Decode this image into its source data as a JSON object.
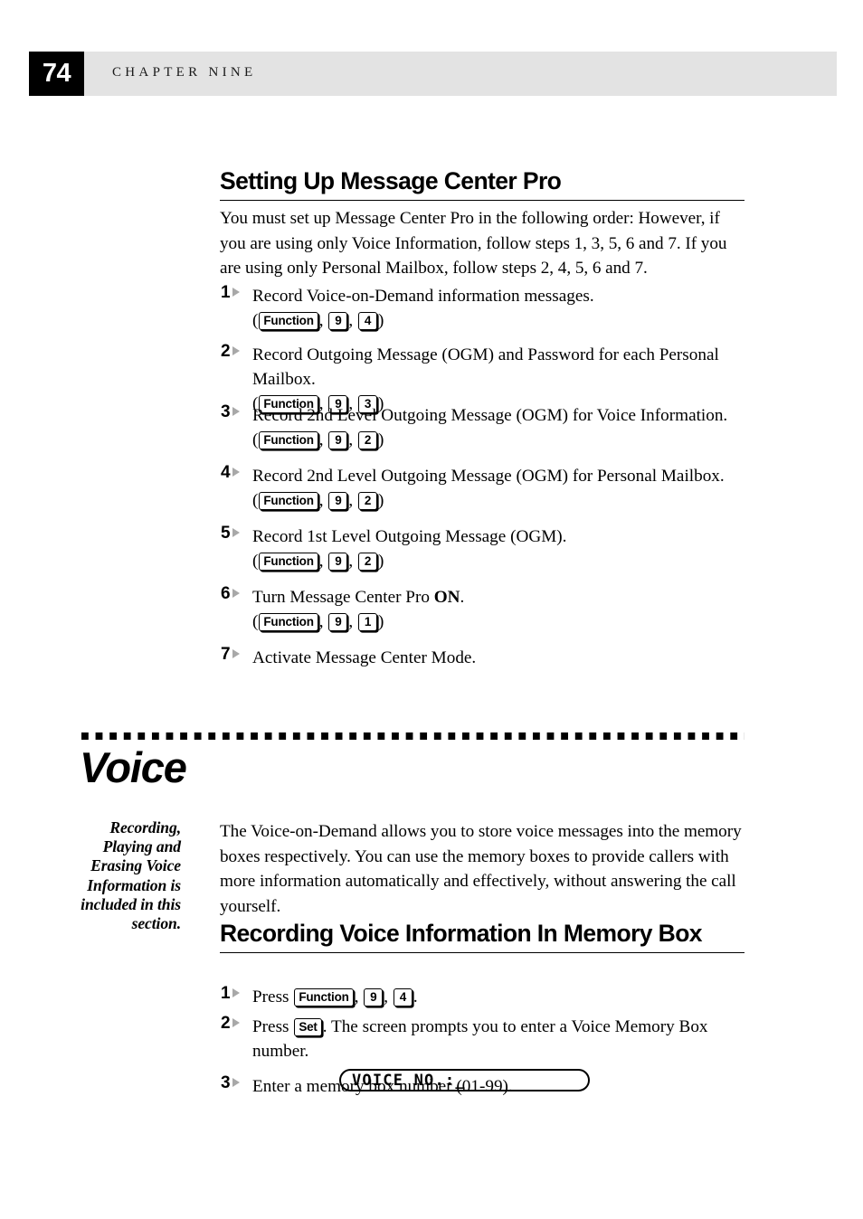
{
  "header": {
    "page_number": "74",
    "chapter_label": "CHAPTER NINE"
  },
  "section1": {
    "heading": "Setting Up Message Center Pro",
    "intro": "You must set up Message Center Pro in the following order: However, if you are using only Voice Information, follow steps 1, 3, 5, 6 and 7. If you are using only Personal Mailbox, follow steps 2, 4, 5, 6 and 7.",
    "steps": [
      {
        "number": "1",
        "text": "Record Voice-on-Demand information messages.",
        "keys": [
          "Function",
          "9",
          "4"
        ]
      },
      {
        "number": "2",
        "text": "Record Outgoing Message (OGM) and Password for each Personal Mailbox.",
        "keys": [
          "Function",
          "9",
          "3"
        ]
      },
      {
        "number": "3",
        "text": "Record 2nd Level Outgoing Message (OGM) for Voice Information.",
        "keys": [
          "Function",
          "9",
          "2"
        ]
      },
      {
        "number": "4",
        "text": "Record 2nd Level Outgoing Message (OGM) for Personal Mailbox.",
        "keys": [
          "Function",
          "9",
          "2"
        ]
      },
      {
        "number": "5",
        "text": "Record 1st Level Outgoing Message (OGM).",
        "keys": [
          "Function",
          "9",
          "2"
        ]
      },
      {
        "number": "6",
        "text_before": "Turn Message Center Pro ",
        "text_bold": "ON",
        "text_after": ".",
        "keys": [
          "Function",
          "9",
          "1"
        ]
      },
      {
        "number": "7",
        "text": "Activate Message Center Mode.",
        "keys": []
      }
    ]
  },
  "section2": {
    "title": "Voice",
    "margin_note": "Recording, Playing and Erasing Voice Information is included in this section.",
    "intro": "The Voice-on-Demand allows you to store voice messages into the memory boxes respectively. You can use the memory boxes to provide callers with more information automatically and effectively, without answering the call yourself.",
    "subheading": "Recording Voice Information In Memory Box",
    "steps": [
      {
        "number": "1",
        "prefix": "Press ",
        "keys": [
          "Function",
          "9",
          "4"
        ],
        "suffix": "."
      },
      {
        "number": "2",
        "prefix": "Press ",
        "keys": [
          "Set"
        ],
        "suffix": ".  The screen prompts you to enter a Voice Memory Box number."
      },
      {
        "number": "3",
        "text": "Enter a memory box number (01-99)."
      }
    ],
    "lcd_display": "VOICE NO.:_"
  }
}
